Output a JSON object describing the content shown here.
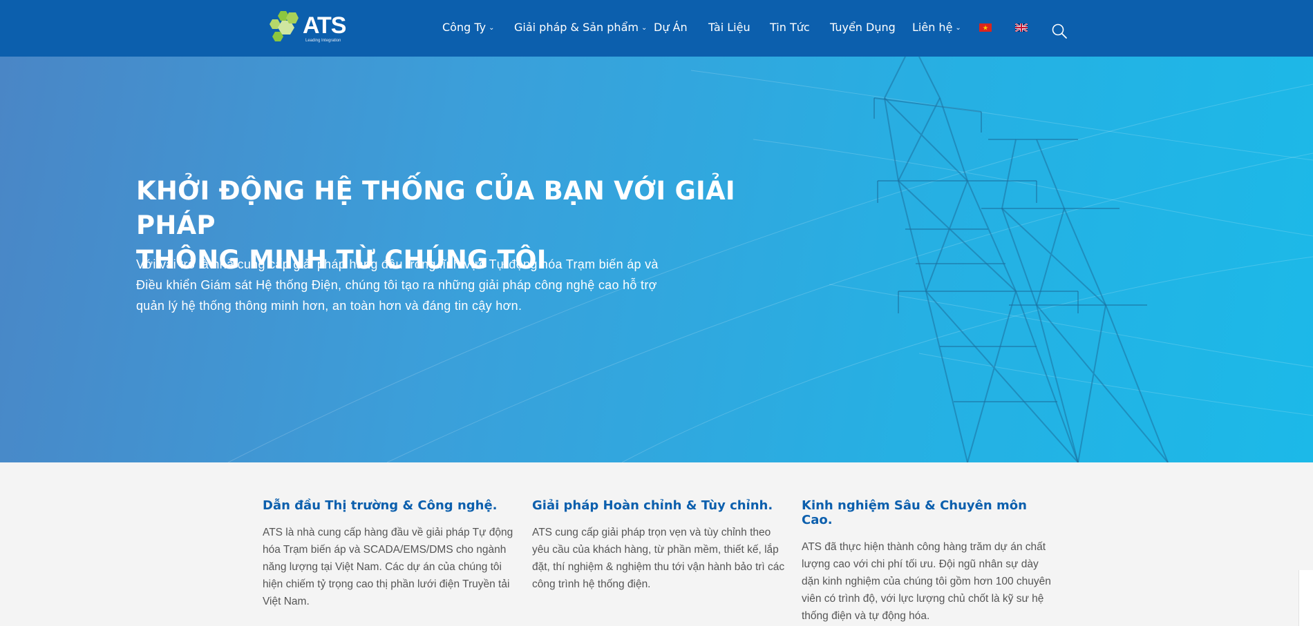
{
  "header": {
    "logo_text": "ATS",
    "logo_tagline": "Leading Integration",
    "nav": [
      {
        "label": "Công Ty",
        "has_dropdown": true
      },
      {
        "label": "Giải pháp & Sản phẩm",
        "has_dropdown": true
      },
      {
        "label": "Dự Án",
        "has_dropdown": false
      },
      {
        "label": "Tài Liệu",
        "has_dropdown": false
      },
      {
        "label": "Tin Tức",
        "has_dropdown": false
      },
      {
        "label": "Tuyển Dụng",
        "has_dropdown": false
      },
      {
        "label": "Liên hệ",
        "has_dropdown": true
      }
    ],
    "caret": "⌄",
    "languages": [
      "vi-flag-icon",
      "uk-flag-icon"
    ],
    "search_icon": "search-icon"
  },
  "hero": {
    "title_line1": "KHỞI ĐỘNG HỆ THỐNG CỦA BẠN VỚI GIẢI PHÁP",
    "title_line2": "THÔNG MINH TỪ CHÚNG TÔI",
    "description": "Với vai trò là nhà cung cấp giải pháp hàng đầu trong lĩnh vực Tự động hóa Trạm biến áp và Điều khiển Giám sát Hệ thống Điện, chúng tôi tạo ra những giải pháp công nghệ cao hỗ trợ quản lý hệ thống thông minh hơn, an toàn hơn và đáng tin cậy hơn."
  },
  "features": [
    {
      "title": "Dẫn đầu Thị trường & Công nghệ.",
      "text": "ATS là nhà cung cấp hàng đầu về giải pháp Tự động hóa Trạm biến áp và SCADA/EMS/DMS cho ngành năng lượng tại Việt Nam. Các dự án của chúng tôi hiện chiếm tỷ trọng cao thị phần lưới điện Truyền tải Việt Nam."
    },
    {
      "title": "Giải pháp Hoàn chỉnh & Tùy chỉnh.",
      "text": "ATS cung cấp giải pháp trọn vẹn và tùy chỉnh theo yêu cầu của khách hàng, từ phần mềm, thiết kế, lắp đặt, thí nghiệm & nghiệm thu tới vận hành bảo trì các công trình hệ thống điện."
    },
    {
      "title": "Kinh nghiệm Sâu & Chuyên môn Cao.",
      "text": "ATS đã thực hiện thành công hàng trăm dự án chất lượng cao với chi phí tối ưu. Đội ngũ nhân sự dày dặn kinh nghiệm của chúng tôi gồm hơn 100 chuyên viên có trình độ, với lực lượng chủ chốt là kỹ sư hệ thống điện và tự động hóa."
    }
  ],
  "colors": {
    "header_bg": "#0c5fad",
    "hero_start": "#4a86c6",
    "hero_end": "#1cb9e8",
    "feature_title": "#0c5fad",
    "logo_green": "#8cc63f"
  }
}
